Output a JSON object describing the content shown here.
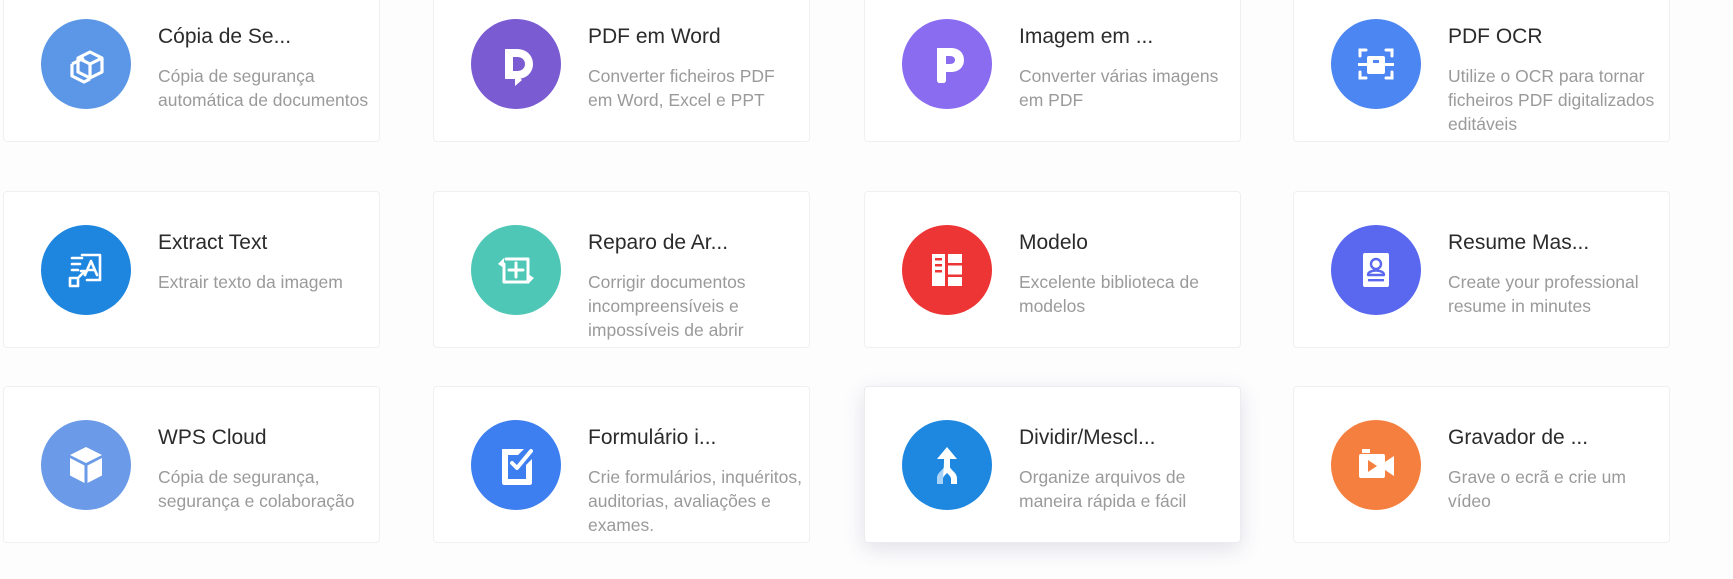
{
  "cards": [
    {
      "title": "Cópia de Se...",
      "description": "Cópia de segurança automática de documentos",
      "icon": "backup-cube-icon",
      "color": "#5b97e6"
    },
    {
      "title": "PDF em Word",
      "description": "Converter ficheiros PDF em Word, Excel e PPT",
      "icon": "pdf-to-word-icon",
      "color": "#7a5bd2"
    },
    {
      "title": "Imagem em ...",
      "description": "Converter várias imagens em PDF",
      "icon": "image-to-pdf-icon",
      "color": "#8a6cf0"
    },
    {
      "title": "PDF OCR",
      "description": "Utilize o OCR para tornar ficheiros PDF digitalizados editáveis",
      "icon": "ocr-scan-icon",
      "color": "#4b86f2"
    },
    {
      "title": "Extract Text",
      "description": "Extrair texto da imagem",
      "icon": "extract-text-icon",
      "color": "#1f86e0"
    },
    {
      "title": "Reparo de Ar...",
      "description": "Corrigir documentos incompreensíveis e impossíveis de abrir",
      "icon": "file-repair-icon",
      "color": "#4ec7b7"
    },
    {
      "title": "Modelo",
      "description": "Excelente biblioteca de modelos",
      "icon": "template-icon",
      "color": "#ee3535"
    },
    {
      "title": "Resume Mas...",
      "description": "Create your professional resume in minutes",
      "icon": "resume-icon",
      "color": "#5a68f0"
    },
    {
      "title": "WPS Cloud",
      "description": "Cópia de segurança, segurança e colaboração",
      "icon": "cloud-cube-icon",
      "color": "#6b9be8"
    },
    {
      "title": "Formulário i...",
      "description": "Crie formulários, inquéritos, auditorias, avaliações e exames.",
      "icon": "form-checklist-icon",
      "color": "#3d7ff0"
    },
    {
      "title": "Dividir/Mescl...",
      "description": "Organize arquivos de maneira rápida e fácil",
      "icon": "split-merge-icon",
      "color": "#1e88e0"
    },
    {
      "title": "Gravador de ...",
      "description": "Grave o ecrã e crie um vídeo",
      "icon": "screen-recorder-icon",
      "color": "#f57f3f"
    }
  ]
}
